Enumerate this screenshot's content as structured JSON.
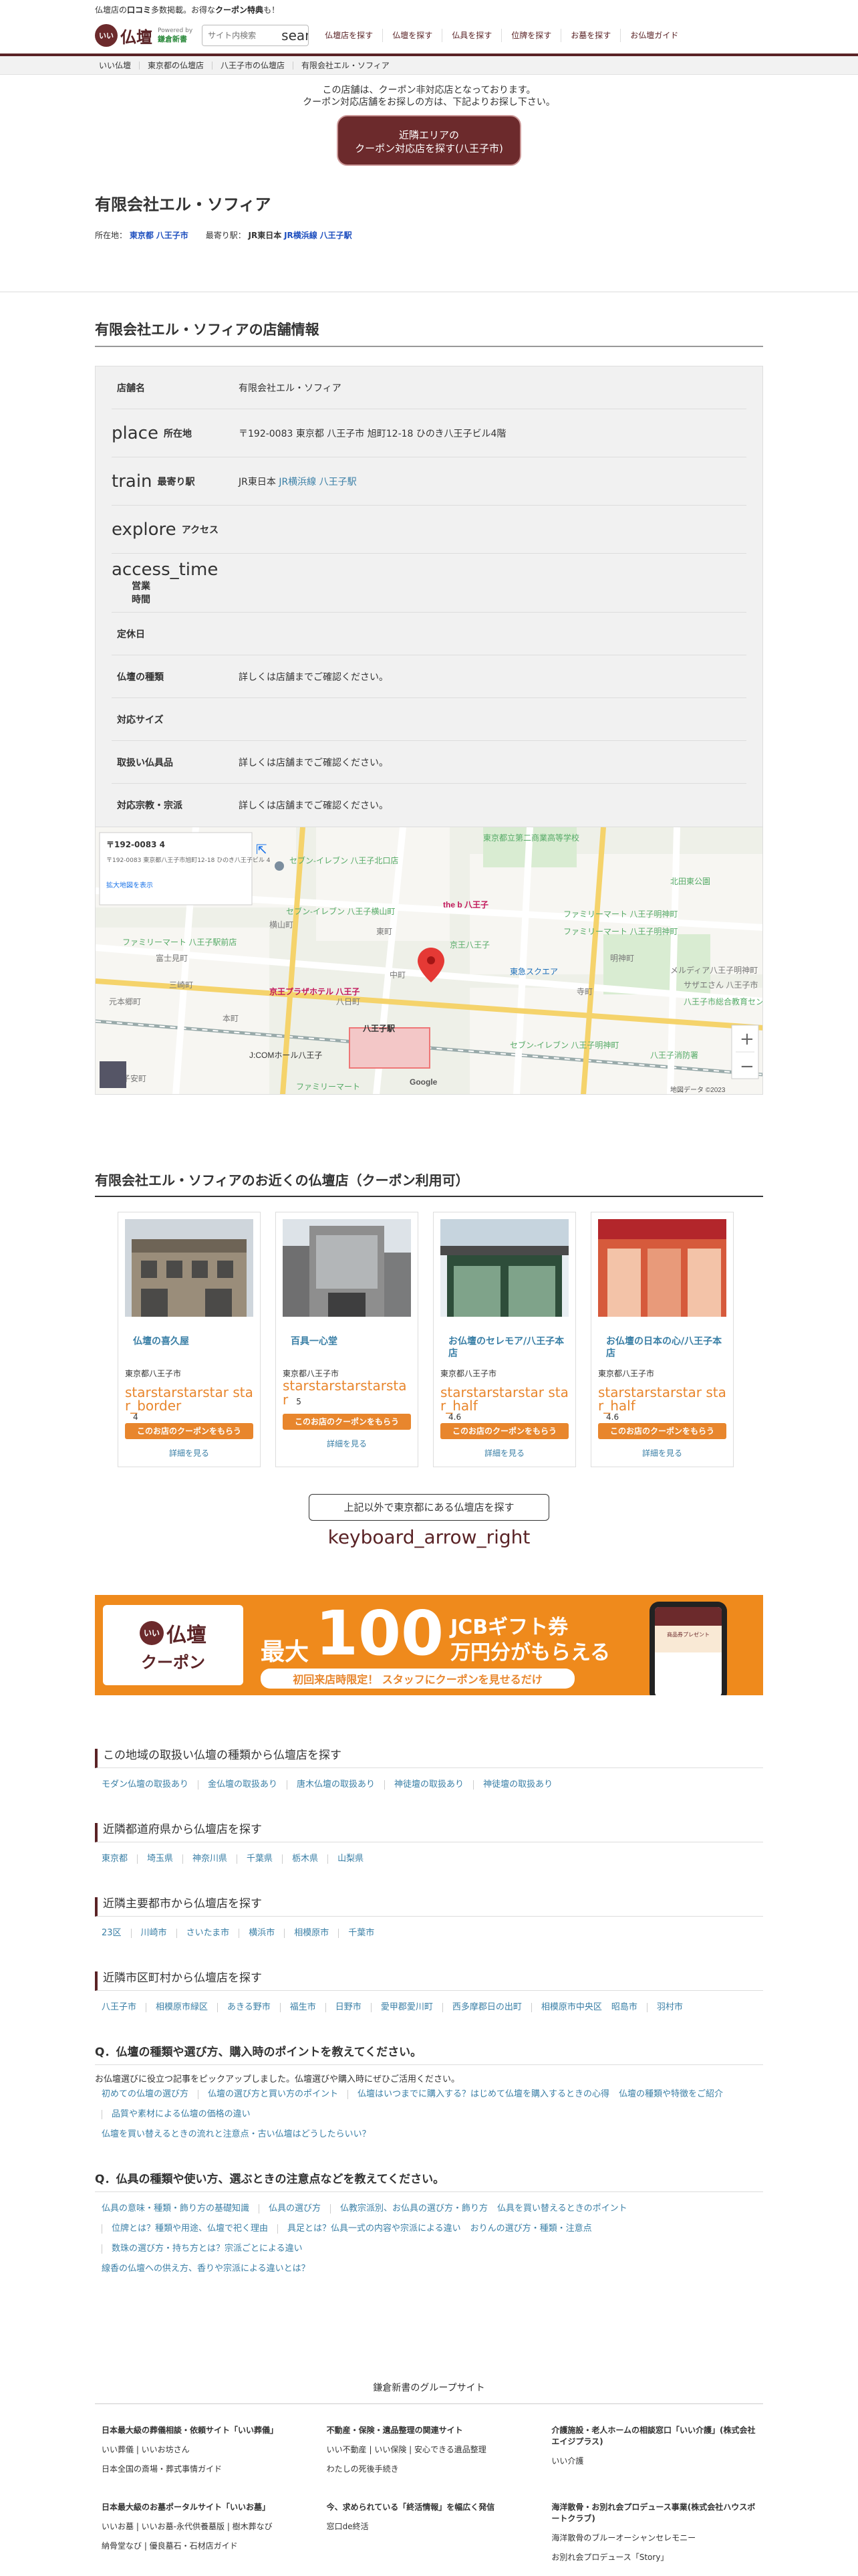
{
  "header": {
    "tagline_prefix": "仏壇店の",
    "tagline_bold1": "口コミ",
    "tagline_mid": "多数掲載。お得な",
    "tagline_bold2": "クーポン特典",
    "tagline_suffix": "も！",
    "logo_badge": "いい",
    "logo_text": "仏壇",
    "powered_by": "Powered by",
    "powered_company": "鎌倉新書",
    "search_placeholder": "サイト内検索",
    "search_icon": "search",
    "nav": [
      "仏壇店を探す",
      "仏壇を探す",
      "仏具を探す",
      "位牌を探す",
      "お墓を探す",
      "お仏壇ガイド"
    ]
  },
  "breadcrumb": [
    "いい仏壇",
    "東京都の仏壇店",
    "八王子市の仏壇店",
    "有限会社エル・ソフィア"
  ],
  "notice": {
    "line1": "この店舗は、クーポン非対応店となっております。",
    "line2": "クーポン対応店舗をお探しの方は、下記よりお探し下さい。",
    "button_line1": "近隣エリアの",
    "button_line2": "クーポン対応店を探す(八王子市)"
  },
  "shop": {
    "name": "有限会社エル・ソフィア",
    "location_label": "所在地：",
    "location_pref": "東京都",
    "location_city": "八王子市",
    "station_label": "最寄り駅：",
    "station_line": "JR東日本",
    "station_link_line": "JR横浜線",
    "station_name": "八王子駅"
  },
  "info": {
    "heading": "有限会社エル・ソフィアの店舗情報",
    "rows": [
      {
        "icon": "",
        "label": "店舗名",
        "value": "有限会社エル・ソフィア"
      },
      {
        "icon": "place",
        "label": "所在地",
        "value": "〒192-0083 東京都 八王子市 旭町12-18 ひのき八王子ビル4階"
      },
      {
        "icon": "train",
        "label": "最寄り駅",
        "value_prefix": "JR東日本",
        "value_link1": "JR横浜線",
        "value_link2": "八王子駅"
      },
      {
        "icon": "explore",
        "label": "アクセス",
        "value": ""
      },
      {
        "icon": "access_time",
        "label": "営業時間",
        "value": ""
      },
      {
        "icon": "",
        "label": "定休日",
        "value": ""
      },
      {
        "icon": "",
        "label": "仏壇の種類",
        "value": "詳しくは店舗までご確認ください。"
      },
      {
        "icon": "",
        "label": "対応サイズ",
        "value": ""
      },
      {
        "icon": "",
        "label": "取扱い仏具品",
        "value": "詳しくは店舗までご確認ください。"
      },
      {
        "icon": "",
        "label": "対応宗教・宗派",
        "value": "詳しくは店舗までご確認ください。"
      }
    ]
  },
  "map": {
    "info_title": "〒192-0083 4",
    "info_addr": "〒192-0083 東京都八王子市旭町12-18 ひのき八王子ビル 4",
    "info_link": "拡大地図を表示",
    "labels": [
      "東京都立第二商業高等学校",
      "セブン-イレブン 八王子北口店",
      "セブン-イレブン 八王子横山町",
      "the b 八王子",
      "ファミリーマート 八王子明神町",
      "ファミリーマート 八王子明神町",
      "東急スクエア",
      "ファミリーマート 八王子駅前店",
      "京王八王子",
      "京王プラザホテル 八王子",
      "八王子駅",
      "J:COMホール八王子",
      "ファミリーマート",
      "セブン-イレブン 八王子明神町",
      "北田東公園",
      "八王子消防署",
      "サザエさん 八王子市",
      "メルディア八王子明神町",
      "八王子市総合教育センター",
      "Google",
      "地図データ ©2023",
      "横山町",
      "東町",
      "明神町",
      "寺町",
      "中町",
      "三崎町",
      "富士見町",
      "元本郷町",
      "本町",
      "子安町",
      "八日町"
    ],
    "zoom_in": "+",
    "zoom_out": "−"
  },
  "nearby": {
    "heading": "有限会社エル・ソフィアのお近くの仏壇店（クーポン利用可）",
    "cards": [
      {
        "name": "仏壇の喜久屋",
        "addr": "東京都八王子市",
        "stars": "starstarstarstar star_border",
        "rating": "4",
        "coupon": "このお店のクーポンをもらう",
        "detail": "詳細を見る"
      },
      {
        "name": "百具一心堂",
        "addr": "東京都八王子市",
        "stars": "starstarstarstarstar",
        "rating": "5",
        "coupon": "このお店のクーポンをもらう",
        "detail": "詳細を見る"
      },
      {
        "name": "お仏壇のセレモア/八王子本店",
        "addr": "東京都八王子市",
        "stars": "starstarstarstar star_half",
        "rating": "4.6",
        "coupon": "このお店のクーポンをもらう",
        "detail": "詳細を見る"
      },
      {
        "name": "お仏壇の日本の心/八王子本店",
        "addr": "東京都八王子市",
        "stars": "starstarstarstar star_half",
        "rating": "4.6",
        "coupon": "このお店のクーポンをもらう",
        "detail": "詳細を見る"
      }
    ],
    "more_button": "上記以外で東京都にある仏壇店を探す",
    "more_icon": "keyboard_arrow_right"
  },
  "banner": {
    "logo_badge": "いい",
    "logo_text": "仏壇",
    "coupon_word": "クーポン",
    "max": "最大",
    "amount": "100",
    "unit": "万円分",
    "jcb": "JCBギフト券",
    "get": "がもらえる",
    "sub": "初回来店時限定！ スタッフにクーポンを見せるだけ",
    "phone_text": "商品券プレゼント"
  },
  "sections": [
    {
      "title": "この地域の取扱い仏壇の種類から仏壇店を探す",
      "links": [
        "モダン仏壇の取扱あり",
        "金仏壇の取扱あり",
        "唐木仏壇の取扱あり",
        "神徒壇の取扱あり",
        "神徒壇の取扱あり"
      ]
    },
    {
      "title": "近隣都道府県から仏壇店を探す",
      "links": [
        "東京都",
        "埼玉県",
        "神奈川県",
        "千葉県",
        "栃木県",
        "山梨県"
      ]
    },
    {
      "title": "近隣主要都市から仏壇店を探す",
      "links": [
        "23区",
        "川崎市",
        "さいたま市",
        "横浜市",
        "相模原市",
        "千葉市"
      ]
    },
    {
      "title": "近隣市区町村から仏壇店を探す",
      "links": [
        "八王子市",
        "相模原市緑区",
        "あきる野市",
        "福生市",
        "日野市",
        "愛甲郡愛川町",
        "西多摩郡日の出町",
        "相模原市中央区",
        "昭島市",
        "羽村市"
      ]
    }
  ],
  "faq": [
    {
      "title": "Q．仏壇の種類や選び方、購入時のポイントを教えてください。",
      "intro": "お仏壇選びに役立つ記事をピックアップしました。仏壇選びや購入時にぜひご活用ください。",
      "links": [
        "初めての仏壇の選び方",
        "仏壇の選び方と買い方のポイント",
        "仏壇はいつまでに購入する？はじめて仏壇を購入するときの心得",
        "仏壇の種類や特徴をご紹介",
        "品質や素材による仏壇の価格の違い",
        "仏壇を買い替えるときの流れと注意点・古い仏壇はどうしたらいい？"
      ]
    },
    {
      "title": "Q．仏具の種類や使い方、選ぶときの注意点などを教えてください。",
      "intro": "",
      "links": [
        "仏具の意味・種類・飾り方の基礎知識",
        "仏具の選び方",
        "仏教宗派別、お仏具の選び方・飾り方",
        "仏具を買い替えるときのポイント",
        "位牌とは？種類や用途、仏壇で祀く理由",
        "具足とは？仏具一式の内容や宗派による違い",
        "おりんの選び方・種類・注意点",
        "数珠の選び方・持ち方とは？宗派ごとによる違い",
        "線香の仏壇への供え方、香りや宗派による違いとは？"
      ]
    }
  ],
  "group": {
    "title": "鎌倉新書のグループサイト",
    "boxes": [
      {
        "title": "日本最大級の葬儀相談・依頼サイト「いい葬儀」",
        "lines": [
          "いい葬儀 | いいお坊さん",
          "日本全国の斎場・葬式事情ガイド"
        ]
      },
      {
        "title": "不動産・保険・遺品整理の関連サイト",
        "lines": [
          "いい不動産 | いい保険 | 安心できる遺品整理",
          "わたしの死後手続き"
        ]
      },
      {
        "title": "介護施設・老人ホームの相談窓口「いい介護」(株式会社エイジプラス)",
        "lines": [
          "いい介護"
        ]
      },
      {
        "title": "日本最大級のお墓ポータルサイト「いいお墓」",
        "lines": [
          "いいお墓 | いいお墓-永代供養墓版 | 樹木葬なび",
          "納骨堂なび | 優良墓石・石材店ガイド"
        ]
      },
      {
        "title": "今、求められている「終活情報」を幅広く発信",
        "lines": [
          "窓口de終活"
        ]
      },
      {
        "title": "海洋散骨・お別れ会プロデュース事業(株式会社ハウスボートクラブ)",
        "lines": [
          "海洋散骨のブルーオーシャンセレモニー",
          "お別れ会プロデュース「Story」"
        ]
      }
    ]
  },
  "colors": {
    "brand": "#5a2326",
    "accent": "#e8862d",
    "link": "#3a7fa6",
    "banner": "#ef8a1c"
  }
}
